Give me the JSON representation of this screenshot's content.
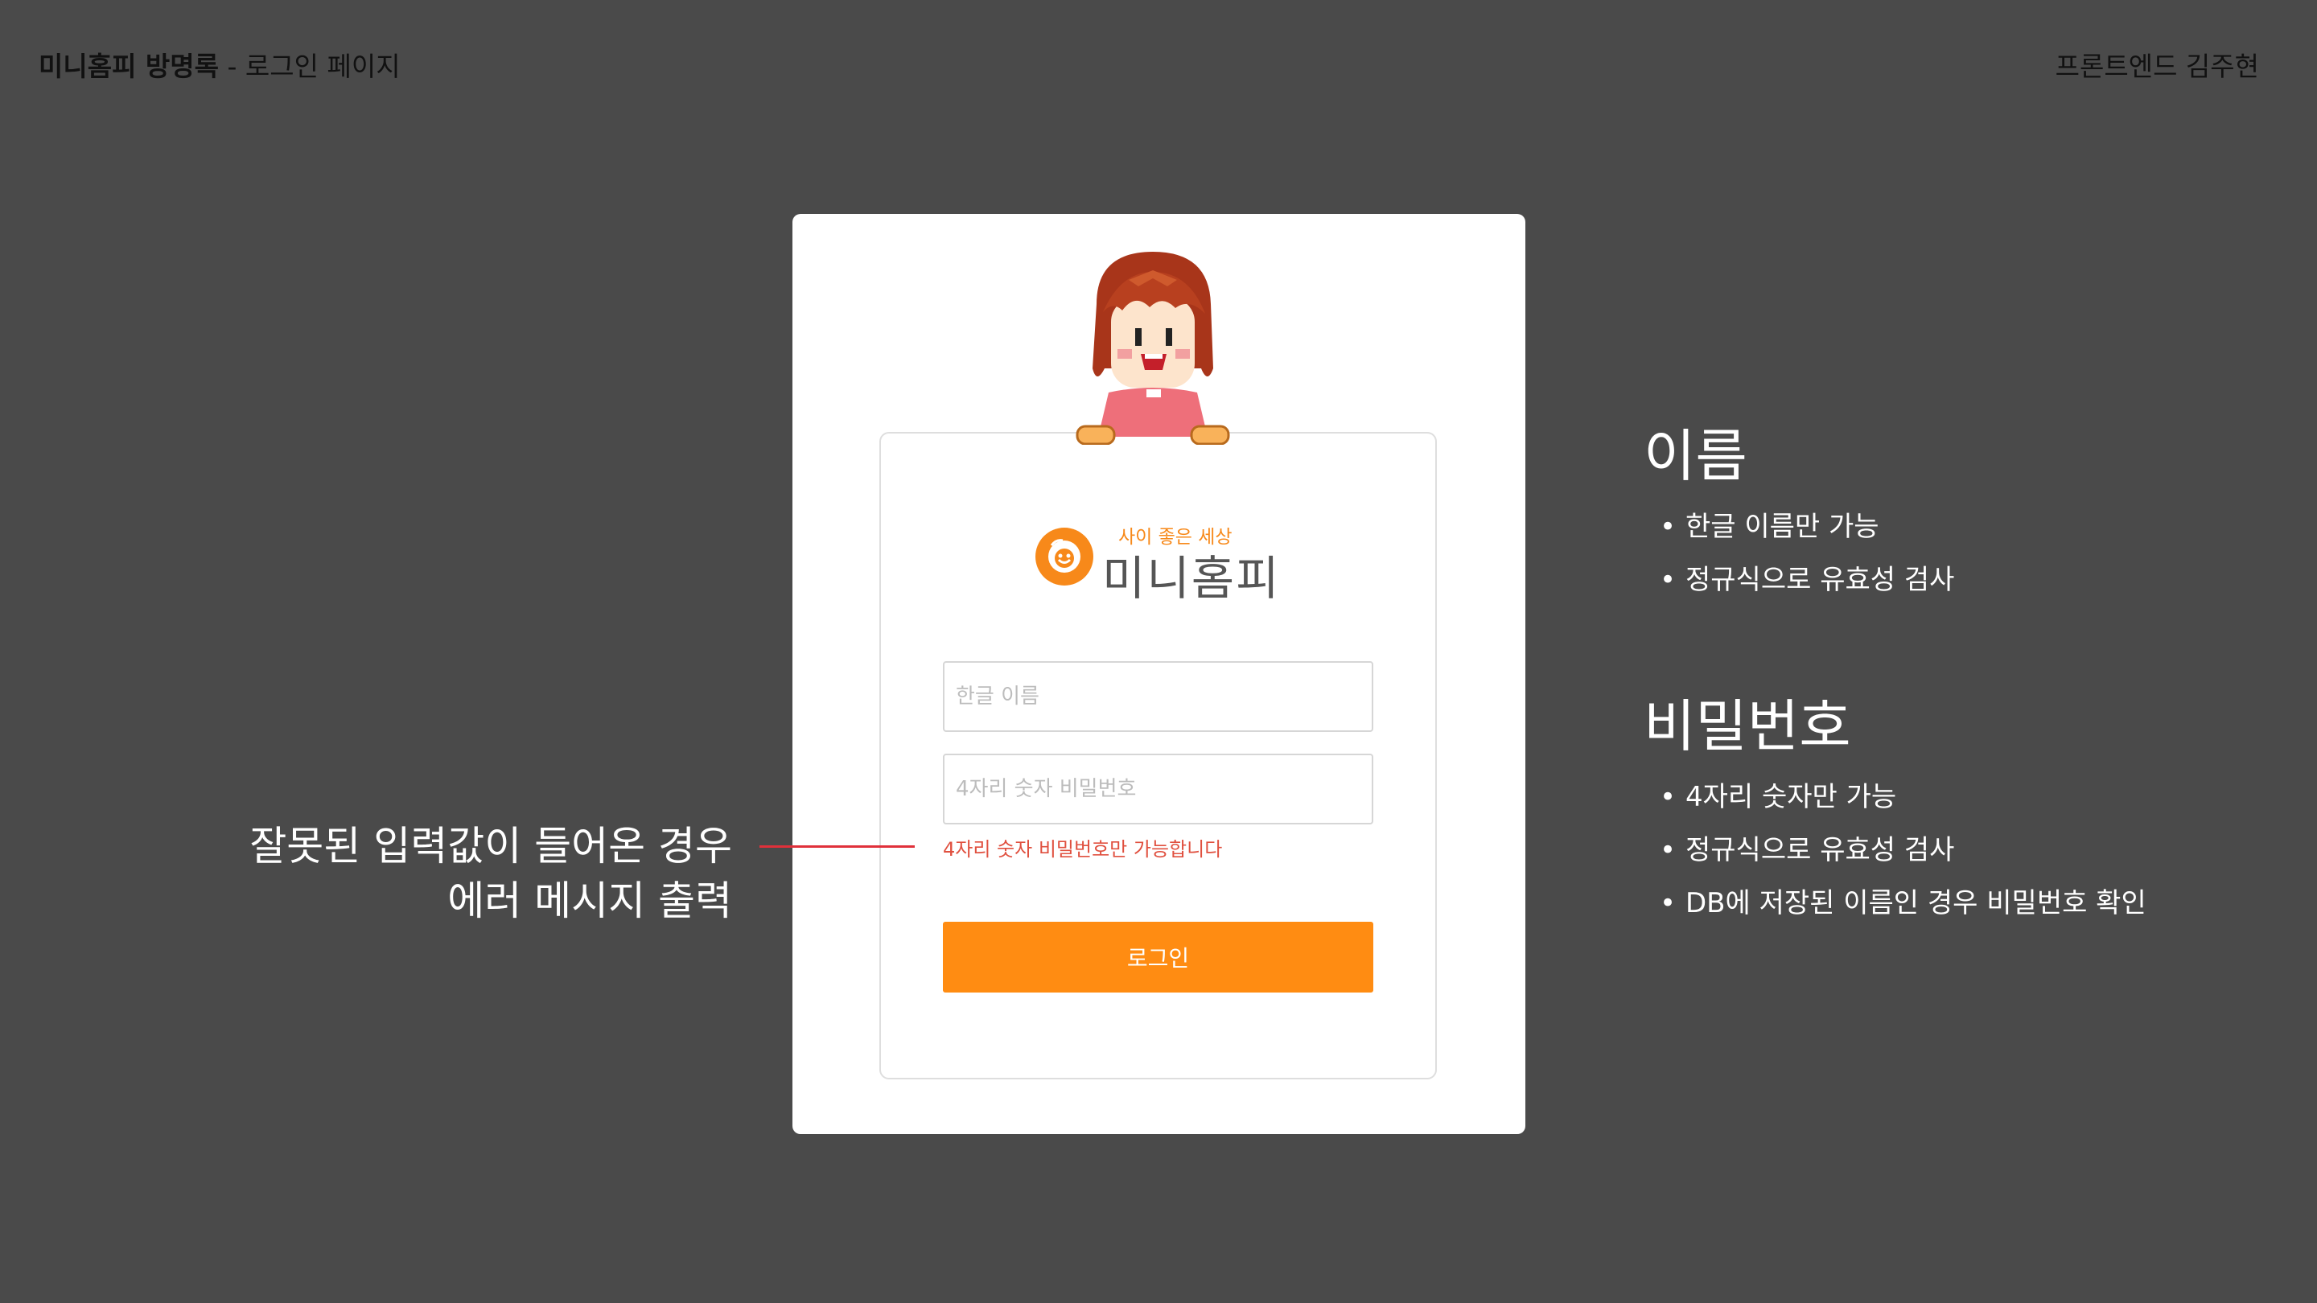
{
  "header": {
    "title_bold": "미니홈피 방명록",
    "title_rest": " - 로그인 페이지",
    "author": "프론트엔드 김주현"
  },
  "login_card": {
    "mascot_icon": "pixel-girl-mascot",
    "logo": {
      "icon": "smiley-face-icon",
      "tagline": "사이 좋은 세상",
      "name": "미니홈피"
    },
    "name_input": {
      "placeholder": "한글 이름",
      "value": ""
    },
    "password_input": {
      "placeholder": "4자리 숫자 비밀번호",
      "value": ""
    },
    "error_message": "4자리 숫자 비밀번호만 가능합니다",
    "login_button": "로그인"
  },
  "annotation": {
    "line1": "잘못된 입력값이 들어온 경우",
    "line2": "에러 메시지 출력"
  },
  "notes": {
    "name": {
      "title": "이름",
      "items": [
        "한글 이름만 가능",
        "정규식으로 유효성 검사"
      ]
    },
    "password": {
      "title": "비밀번호",
      "items": [
        "4자리 숫자만 가능",
        "정규식으로 유효성 검사",
        "DB에 저장된 이름인 경우 비밀번호 확인"
      ]
    }
  },
  "colors": {
    "background": "#4a4a4a",
    "accent_orange": "#ff8c12",
    "error_red": "#e0503f",
    "annotation_line": "#e0303a"
  }
}
